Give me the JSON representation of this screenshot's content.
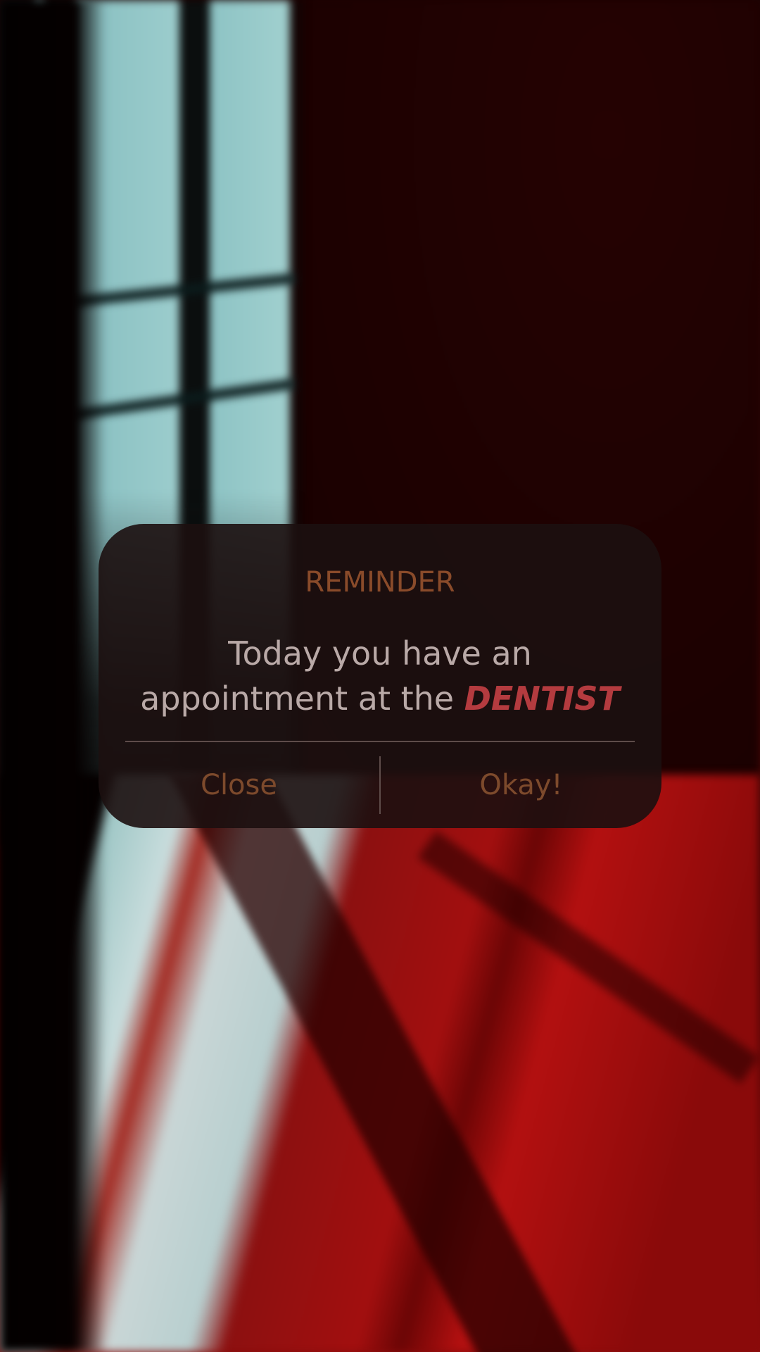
{
  "dialog": {
    "title": "REMINDER",
    "message_line1": "Today you have an",
    "message_line2_prefix": "appointment at the ",
    "message_highlight": "DENTIST",
    "buttons": {
      "close_label": "Close",
      "okay_label": "Okay!"
    }
  },
  "colors": {
    "title": "#8a4b2a",
    "message": "#b9a9a7",
    "highlight": "#b43b3f",
    "button_text": "#7d4a2c",
    "dialog_bg": "#1c1010"
  }
}
